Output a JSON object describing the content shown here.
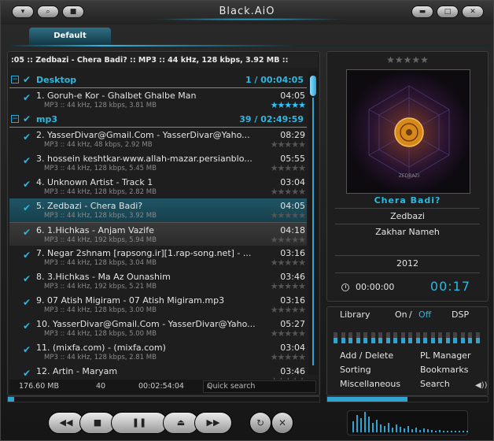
{
  "app": {
    "title": "Black.AiO"
  },
  "window_buttons": [
    {
      "name": "menu-button",
      "icon": "chevron-down-icon"
    },
    {
      "name": "search-button",
      "icon": "search-icon"
    },
    {
      "name": "save-button",
      "icon": "floppy-icon"
    },
    {
      "name": "minimize-button",
      "icon": "minimize-icon"
    },
    {
      "name": "maximize-button",
      "icon": "maximize-icon"
    },
    {
      "name": "close-button",
      "icon": "close-icon"
    }
  ],
  "tab": {
    "label": "Default"
  },
  "now_playing_marquee": ":05 :: Zedbazi - Chera Badi? :: MP3 :: 44 kHz, 128 kbps, 3.92 MB ::",
  "groups": [
    {
      "name": "Desktop",
      "info": "1 / 00:04:05"
    },
    {
      "name": "mp3",
      "info": "39 / 02:49:59"
    }
  ],
  "tracks": [
    {
      "title": "1. Goruh-e Kor - Ghalbet Ghalbe Man",
      "duration": "04:05",
      "meta": "MP3 :: 44 kHz, 128 kbps, 3.81 MB",
      "rating": 5,
      "group": 0
    },
    {
      "title": "2. YasserDivar@Gmail.Com - YasserDivar@Yaho...",
      "duration": "08:29",
      "meta": "MP3 :: 44 kHz, 48 kbps, 2.92 MB",
      "rating": 0,
      "group": 1
    },
    {
      "title": "3. hossein keshtkar-www.allah-mazar.persianblo...",
      "duration": "05:55",
      "meta": "MP3 :: 44 kHz, 128 kbps, 5.45 MB",
      "rating": 0,
      "group": 1
    },
    {
      "title": "4. Unknown Artist - Track 1",
      "duration": "03:04",
      "meta": "MP3 :: 44 kHz, 128 kbps, 2.82 MB",
      "rating": 0,
      "group": 1
    },
    {
      "title": "5. Zedbazi - Chera Badi?",
      "duration": "04:05",
      "meta": "MP3 :: 44 kHz, 128 kbps, 3.92 MB",
      "rating": 0,
      "group": 1,
      "state": "playing"
    },
    {
      "title": "6. 1.Hichkas - Anjam Vazife",
      "duration": "04:18",
      "meta": "MP3 :: 44 kHz, 192 kbps, 5.94 MB",
      "rating": 0,
      "group": 1,
      "state": "focused"
    },
    {
      "title": "7. Negar 2shnam [rapsong.ir][1.rap-song.net] - ...",
      "duration": "03:16",
      "meta": "MP3 :: 44 kHz, 128 kbps, 3.04 MB",
      "rating": 0,
      "group": 1
    },
    {
      "title": "8. 3.Hichkas - Ma Az Ounashim",
      "duration": "03:46",
      "meta": "MP3 :: 44 kHz, 192 kbps, 5.21 MB",
      "rating": 0,
      "group": 1
    },
    {
      "title": "9. 07 Atish Migiram - 07 Atish Migiram.mp3",
      "duration": "03:16",
      "meta": "MP3 :: 44 kHz, 128 kbps, 3.00 MB",
      "rating": 0,
      "group": 1
    },
    {
      "title": "10. YasserDivar@Gmail.Com - YasserDivar@Yaho...",
      "duration": "05:27",
      "meta": "MP3 :: 44 kHz, 128 kbps, 5.00 MB",
      "rating": 0,
      "group": 1
    },
    {
      "title": "11. (mixfa.com) - (mixfa.com)",
      "duration": "03:04",
      "meta": "MP3 :: 44 kHz, 128 kbps, 2.81 MB",
      "rating": 0,
      "group": 1
    },
    {
      "title": "12. Artin - Maryam",
      "duration": "03:46",
      "meta": "",
      "rating": 0,
      "group": 1
    }
  ],
  "playlist_footer": {
    "size": "176.60 MB",
    "count": "40",
    "total_time": "00:02:54:04",
    "search_placeholder": "Quick search"
  },
  "info_panel": {
    "rating": 0,
    "cover_text": "ZEDBAZI",
    "title": "Chera Badi?",
    "artist": "Zedbazi",
    "album": "Zakhar Nameh",
    "year": "2012",
    "elapsed": "00:00:00",
    "remaining": "00:17"
  },
  "library_panel": {
    "library_label": "Library",
    "on_label": "On",
    "slash": "/",
    "off_label": "Off",
    "dsp_label": "DSP",
    "eq_levels": [
      0.5,
      0.5,
      0.5,
      0.5,
      0.5,
      0.5,
      0.5,
      0.5,
      0.5,
      0.5,
      0.5,
      0.5,
      0.5,
      0.5,
      0.5,
      0.5,
      0.5,
      0.5,
      0.5,
      0.5
    ],
    "menu": [
      "Add / Delete",
      "PL Manager",
      "Sorting",
      "Bookmarks",
      "Miscellaneous",
      "Search"
    ]
  },
  "playback_progress": 0.02,
  "library_progress": 0.5,
  "transport": [
    {
      "name": "previous-button",
      "icon": "previous-icon"
    },
    {
      "name": "stop-button",
      "icon": "stop-icon"
    },
    {
      "name": "pause-button",
      "icon": "pause-icon"
    },
    {
      "name": "eject-button",
      "icon": "eject-icon"
    },
    {
      "name": "next-button",
      "icon": "next-icon"
    },
    {
      "name": "repeat-button",
      "icon": "repeat-icon"
    },
    {
      "name": "shuffle-button",
      "icon": "shuffle-icon"
    }
  ],
  "colors": {
    "accent": "#2fb7e0",
    "background": "#1e1e1e",
    "playing_row": "#1f5565"
  }
}
